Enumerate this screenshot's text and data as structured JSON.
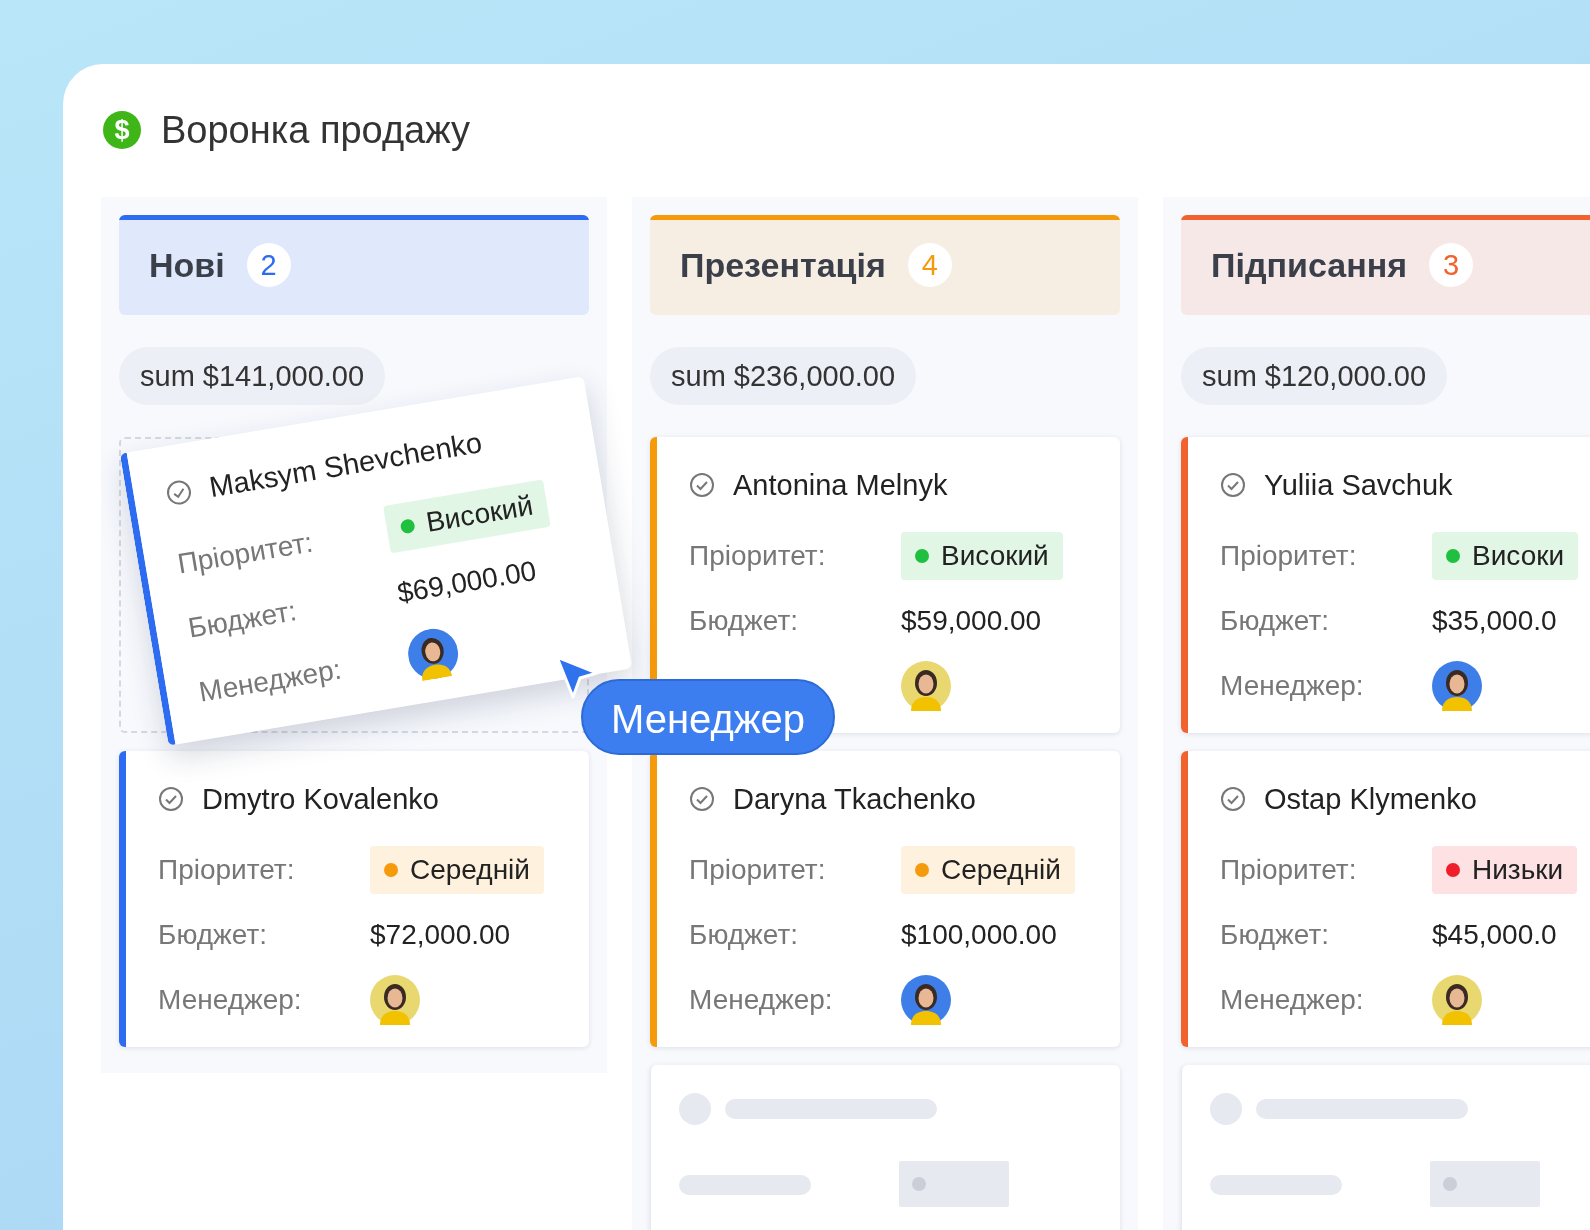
{
  "title": "Воронка продажу",
  "title_icon": "$",
  "columns": [
    {
      "name": "Нові",
      "count": "2",
      "color": "#2d6cf0",
      "sum": "sum $141,000.00",
      "skeleton": false,
      "cards": [
        {
          "kind": "dragged",
          "name": "Maksym Shevchenko",
          "priority_label": "Пріоритет:",
          "priority": {
            "label": "Високий",
            "color": "#1fbf3f"
          },
          "budget_label": "Бюджет:",
          "budget": "$69,000.00",
          "manager_label": "Менеджер:",
          "manager": {
            "color": "#3d7ee8"
          }
        },
        {
          "kind": "normal",
          "name": "Dmytro Kovalenko",
          "priority_label": "Пріоритет:",
          "priority": {
            "label": "Середній",
            "color": "#f59a0b"
          },
          "budget_label": "Бюджет:",
          "budget": "$72,000.00",
          "manager_label": "Менеджер:",
          "manager": {
            "color": "#e9d870"
          }
        }
      ]
    },
    {
      "name": "Презентація",
      "count": "4",
      "color": "#f59a0b",
      "sum": "sum $236,000.00",
      "skeleton": true,
      "cards": [
        {
          "kind": "normal",
          "name": "Antonina Melnyk",
          "priority_label": "Пріоритет:",
          "priority": {
            "label": "Високий",
            "color": "#1fbf3f"
          },
          "budget_label": "Бюджет:",
          "budget": "$59,000.00",
          "manager": {
            "color": "#e9d870"
          }
        },
        {
          "kind": "normal",
          "name": "Daryna Tkachenko",
          "priority_label": "Пріоритет:",
          "priority": {
            "label": "Середній",
            "color": "#f59a0b"
          },
          "budget_label": "Бюджет:",
          "budget": "$100,000.00",
          "manager_label": "Менеджер:",
          "manager": {
            "color": "#3d7ee8"
          }
        }
      ]
    },
    {
      "name": "Підписання",
      "count": "3",
      "color": "#f2622e",
      "sum": "sum $120,000.00",
      "skeleton": true,
      "cards": [
        {
          "kind": "normal",
          "name": "Yuliia Savchuk",
          "priority_label": "Пріоритет:",
          "priority": {
            "label": "Високи",
            "color": "#1fbf3f"
          },
          "budget_label": "Бюджет:",
          "budget": "$35,000.0",
          "manager_label": "Менеджер:",
          "manager": {
            "color": "#3d7ee8"
          }
        },
        {
          "kind": "normal",
          "name": "Ostap Klymenko",
          "priority_label": "Пріоритет:",
          "priority": {
            "label": "Низьки",
            "color": "#f01d2a"
          },
          "budget_label": "Бюджет:",
          "budget": "$45,000.0",
          "manager_label": "Менеджер:",
          "manager": {
            "color": "#e9d870"
          }
        }
      ]
    }
  ],
  "tooltip": {
    "label": "Менеджер"
  }
}
